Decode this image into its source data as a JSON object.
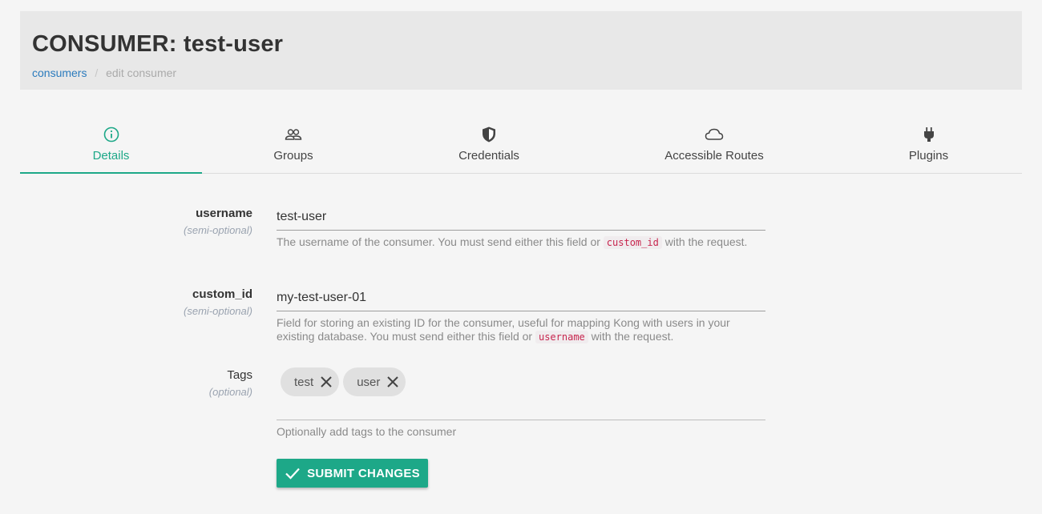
{
  "header": {
    "title": "CONSUMER: test-user",
    "breadcrumb": {
      "link": "consumers",
      "separator": "/",
      "current": "edit consumer"
    }
  },
  "tabs": [
    {
      "label": "Details",
      "icon": "info-icon",
      "active": true
    },
    {
      "label": "Groups",
      "icon": "group-icon",
      "active": false
    },
    {
      "label": "Credentials",
      "icon": "shield-icon",
      "active": false
    },
    {
      "label": "Accessible Routes",
      "icon": "cloud-icon",
      "active": false
    },
    {
      "label": "Plugins",
      "icon": "plug-icon",
      "active": false
    }
  ],
  "form": {
    "username": {
      "label": "username",
      "sub": "(semi-optional)",
      "value": "test-user",
      "help_before": "The username of the consumer. You must send either this field or ",
      "help_code": "custom_id",
      "help_after": " with the request."
    },
    "custom_id": {
      "label": "custom_id",
      "sub": "(semi-optional)",
      "value": "my-test-user-01",
      "help_before": "Field for storing an existing ID for the consumer, useful for mapping Kong with users in your existing database. You must send either this field or ",
      "help_code": "username",
      "help_after": " with the request."
    },
    "tags": {
      "label": "Tags",
      "sub": "(optional)",
      "chips": [
        "test",
        "user"
      ],
      "help": "Optionally add tags to the consumer"
    }
  },
  "submit_label": "SUBMIT CHANGES",
  "colors": {
    "accent": "#1da888",
    "link": "#2b7bbd",
    "code": "#c7254e"
  }
}
